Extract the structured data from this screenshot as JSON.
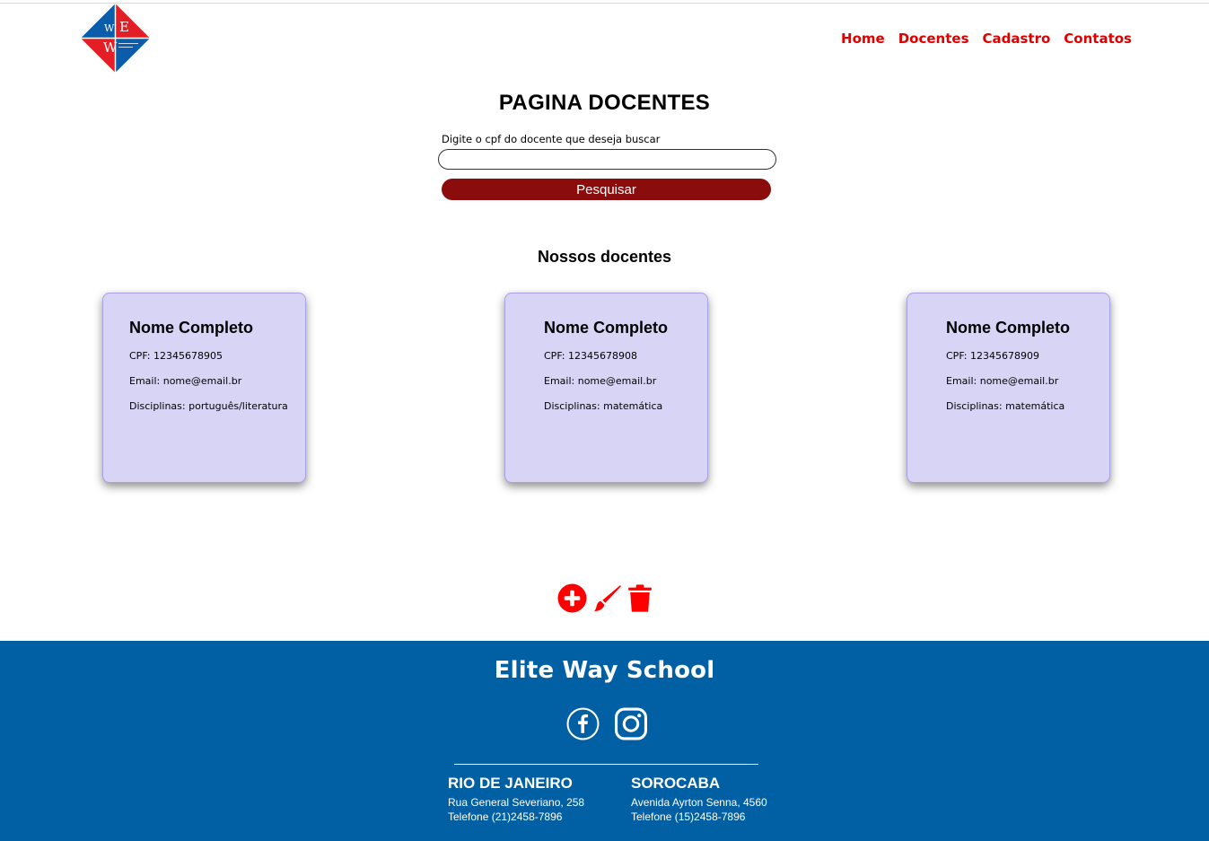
{
  "header": {
    "logo_letters": [
      "W",
      "E",
      "W"
    ],
    "nav": [
      {
        "label": "Home"
      },
      {
        "label": "Docentes"
      },
      {
        "label": "Cadastro"
      },
      {
        "label": "Contatos"
      }
    ]
  },
  "main": {
    "title": "PAGINA DOCENTES",
    "search": {
      "label": "Digite o cpf do docente que deseja buscar",
      "value": "",
      "placeholder": "",
      "button_label": "Pesquisar"
    },
    "section_title": "Nossos docentes",
    "cards": [
      {
        "name": "Nome Completo",
        "cpf": "CPF: 12345678905",
        "email": "Email: nome@email.br",
        "disciplinas": "Disciplinas: português/literatura"
      },
      {
        "name": "Nome Completo",
        "cpf": "CPF: 12345678908",
        "email": "Email: nome@email.br",
        "disciplinas": "Disciplinas: matemática"
      },
      {
        "name": "Nome Completo",
        "cpf": "CPF: 12345678909",
        "email": "Email: nome@email.br",
        "disciplinas": "Disciplinas: matemática"
      }
    ],
    "actions": [
      {
        "icon": "plus-circle-icon"
      },
      {
        "icon": "brush-icon"
      },
      {
        "icon": "trash-icon"
      }
    ]
  },
  "footer": {
    "title": "Elite Way School",
    "social": [
      {
        "icon": "facebook-icon"
      },
      {
        "icon": "instagram-icon"
      }
    ],
    "cities": [
      {
        "name": "RIO DE JANEIRO",
        "address": "Rua General Severiano, 258",
        "phone": "Telefone (21)2458-7896"
      },
      {
        "name": "SOROCABA",
        "address": "Avenida Ayrton Senna, 4560",
        "phone": "Telefone (15)2458-7896"
      }
    ]
  },
  "colors": {
    "nav_red": "#e00000",
    "button_red": "#8b0c0c",
    "card_bg": "#d8d4f6",
    "footer_blue": "#0060a3",
    "icon_red": "#ff0000"
  }
}
